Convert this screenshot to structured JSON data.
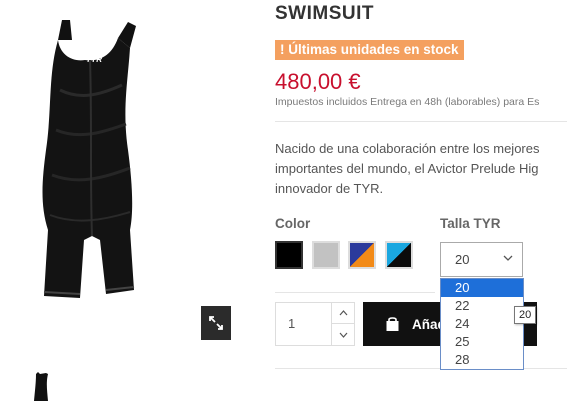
{
  "product": {
    "title": "SWIMSUIT",
    "stock_badge": "Últimas unidades en stock",
    "price": "480,00 €",
    "tax_note": "Impuestos incluidos Entrega en 48h (laborables) para Es",
    "description_lines": [
      "Nacido de una colaboración entre los mejores",
      "importantes del mundo, el Avictor Prelude Hig",
      "innovador de TYR."
    ],
    "brand_logo": "TYR"
  },
  "options": {
    "color_label": "Color",
    "size_label": "Talla TYR",
    "selected_size": "20",
    "size_options": [
      "20",
      "22",
      "24",
      "25",
      "28"
    ],
    "swatches": [
      {
        "name": "black",
        "colors": [
          "#000000"
        ]
      },
      {
        "name": "grey",
        "colors": [
          "#c2c2c2"
        ]
      },
      {
        "name": "navy-orange",
        "colors": [
          "#2b3a9c",
          "#f28a17"
        ]
      },
      {
        "name": "black-cyan",
        "colors": [
          "#0b0b0b",
          "#1aa7e0"
        ]
      }
    ]
  },
  "cart": {
    "quantity": "1",
    "add_button_label": "Añadir al carrito"
  },
  "tooltip": "20",
  "icons": {
    "zoom": "expand-icon",
    "cart": "shopping-bag-icon",
    "stepper_up": "chevron-up-icon",
    "stepper_down": "chevron-down-icon",
    "select": "chevron-down-icon",
    "stock": "exclamation-icon"
  },
  "colors": {
    "price": "#c8102e",
    "badge": "#f4a05f",
    "button": "#111111",
    "dropdown_highlight": "#1e6fd9"
  }
}
